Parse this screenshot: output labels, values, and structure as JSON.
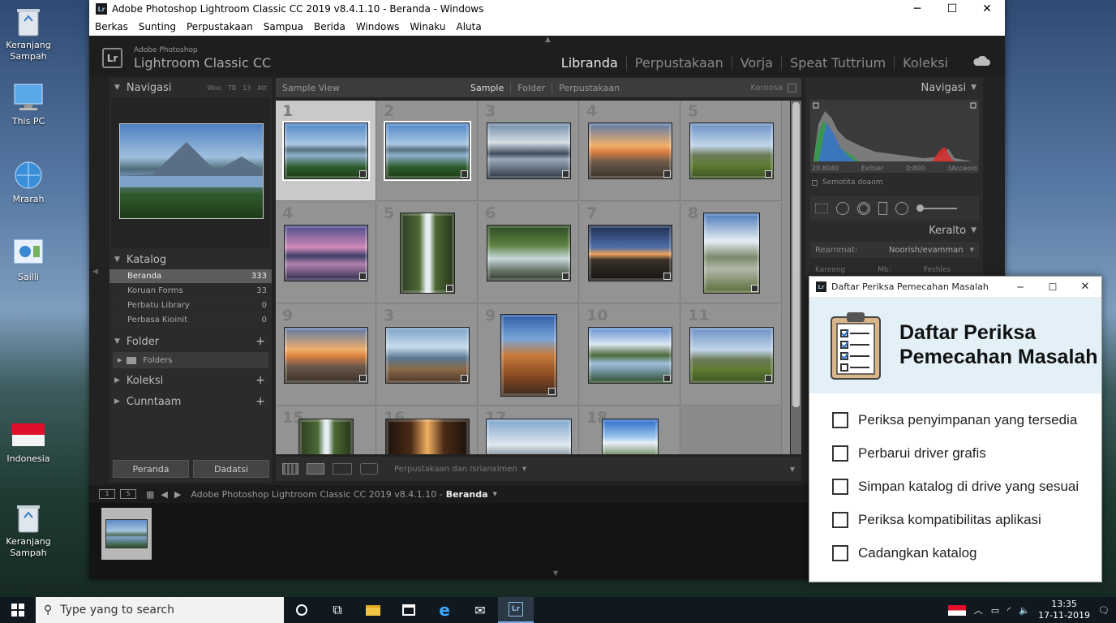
{
  "desktop": {
    "icons": [
      {
        "label": "Keranjang Sampah",
        "icon": "recycle-bin-icon"
      },
      {
        "label": "This PC",
        "icon": "computer-icon"
      },
      {
        "label": "Mrarah",
        "icon": "network-icon"
      },
      {
        "label": "Sailli",
        "icon": "control-panel-icon"
      },
      {
        "label": "Indonesia",
        "icon": "flag-icon"
      },
      {
        "label": "Keranjang Sampah",
        "icon": "recycle-bin-icon"
      }
    ]
  },
  "window": {
    "title": "Adobe Photoshop Lightroom Classic CC 2019 v8.4.1.10 - Beranda - Windows",
    "app_icon": "Lr",
    "menu": [
      "Berkas",
      "Sunting",
      "Perpustakaan",
      "Sampua",
      "Berida",
      "Windows",
      "Winaku",
      "Aluta"
    ]
  },
  "header": {
    "brand_small": "Adobe Photoshop",
    "brand_large": "Lightroom Classic CC",
    "modules": [
      "Libranda",
      "Perpustakaan",
      "Vorja",
      "Speat Tuttrium",
      "Koleksi"
    ]
  },
  "left": {
    "navigator": {
      "title": "Navigasi",
      "zoom": [
        "Woo",
        "TB",
        "13",
        "Att"
      ]
    },
    "catalog": {
      "title": "Katalog",
      "items": [
        {
          "label": "Beranda",
          "count": "333"
        },
        {
          "label": "Koruan Forms",
          "count": "33"
        },
        {
          "label": "Perbatu Library",
          "count": "0"
        },
        {
          "label": "Perbasa Kioinit",
          "count": "0"
        }
      ]
    },
    "folder": {
      "title": "Folder",
      "item": "Folders"
    },
    "koleksi": {
      "title": "Koleksi"
    },
    "cunntaam": {
      "title": "Cunntaam"
    },
    "buttons": {
      "import": "Peranda",
      "export": "Dadatsi"
    }
  },
  "filterbar": {
    "left": "Sample View",
    "tabs": [
      "Sample",
      "Folder",
      "Perpustakaan"
    ],
    "right": "Koroosa"
  },
  "grid": {
    "cells": [
      {
        "n": "1",
        "t": "lake"
      },
      {
        "n": "2",
        "t": "lake"
      },
      {
        "n": "3",
        "t": "clouds"
      },
      {
        "n": "4",
        "t": "sunset"
      },
      {
        "n": "5",
        "t": "hills"
      },
      {
        "n": "4",
        "t": "purple"
      },
      {
        "n": "5",
        "t": "waterfall"
      },
      {
        "n": "6",
        "t": "river"
      },
      {
        "n": "7",
        "t": "dusk"
      },
      {
        "n": "8",
        "t": "valley"
      },
      {
        "n": "9",
        "t": "sunset"
      },
      {
        "n": "3",
        "t": "coast"
      },
      {
        "n": "9",
        "t": "rock"
      },
      {
        "n": "10",
        "t": "reflect"
      },
      {
        "n": "11",
        "t": "hills"
      },
      {
        "n": "15",
        "t": "waterfall"
      },
      {
        "n": "16",
        "t": "cave"
      },
      {
        "n": "17",
        "t": "fog"
      },
      {
        "n": "18",
        "t": "sky"
      }
    ]
  },
  "toolbar": {
    "sort": "Perpustakaan dan Isrianxlmen"
  },
  "right": {
    "histogram": {
      "title": "Navigasi",
      "labels": [
        "20.8040",
        "Exitser",
        "0:800",
        "3Acceoro"
      ],
      "option": "Semotita doaom"
    },
    "quick": {
      "title": "Keralto",
      "label": "Rearnmat:",
      "value": "Noorish/evamman",
      "row2a": "Kareeng",
      "row2b": "Mb:",
      "row2c": "Feshles"
    }
  },
  "filmstrip": {
    "path": "Adobe Photoshop Lightroom Classic CC 2019 v8.4.1.10 -",
    "source": "Beranda",
    "pages": [
      "1",
      "S"
    ]
  },
  "dialog": {
    "title": "Daftar Periksa Pemecahan Masalah",
    "heading1": "Daftar Periksa",
    "heading2": "Pemecahan Masalah",
    "items": [
      "Periksa penyimpanan yang tersedia",
      "Perbarui driver grafis",
      "Simpan katalog di drive yang sesuai",
      "Periksa kompatibilitas aplikasi",
      "Cadangkan katalog"
    ]
  },
  "taskbar": {
    "search_placeholder": "Type yang to search",
    "time": "13:35",
    "date": "17-11-2019"
  }
}
